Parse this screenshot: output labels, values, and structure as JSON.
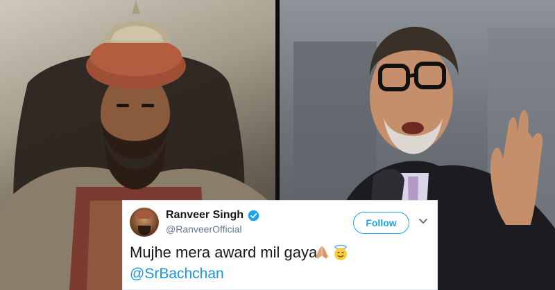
{
  "tweet": {
    "display_name": "Ranveer Singh",
    "handle": "@RanveerOfficial",
    "follow_label": "Follow",
    "text": "Mujhe mera award mil gaya",
    "emojis": [
      "folded-hands-icon",
      "smiling-face-with-halo-icon"
    ],
    "mention": "@SrBachchan"
  },
  "colors": {
    "twitter_blue": "#1da1f2",
    "mention_blue": "#1b95e0",
    "name_text": "#14171a",
    "handle_text": "#657786"
  }
}
